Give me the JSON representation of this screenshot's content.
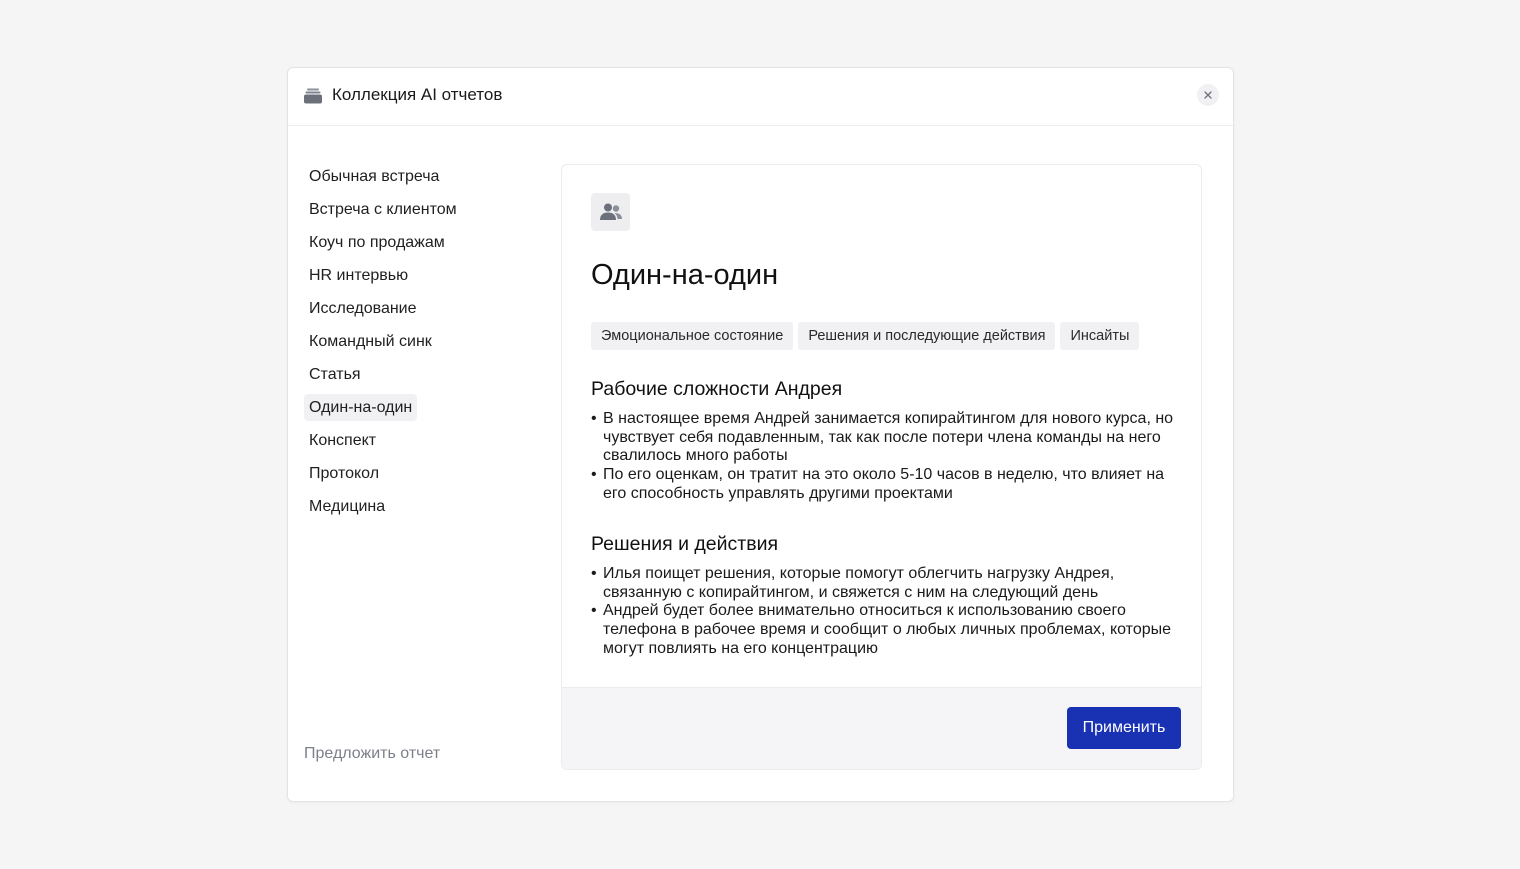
{
  "dialog": {
    "title": "Коллекция AI отчетов",
    "header_icon": "archive-box-icon",
    "close_icon": "close-icon"
  },
  "sidebar": {
    "items": [
      {
        "label": "Обычная встреча"
      },
      {
        "label": "Встреча с клиентом"
      },
      {
        "label": "Коуч по продажам"
      },
      {
        "label": "HR интервью"
      },
      {
        "label": "Исследование"
      },
      {
        "label": "Командный синк"
      },
      {
        "label": "Статья"
      },
      {
        "label": "Один-на-один",
        "active": true
      },
      {
        "label": "Конспект"
      },
      {
        "label": "Протокол"
      },
      {
        "label": "Медицина"
      }
    ],
    "suggest_label": "Предложить отчет"
  },
  "template": {
    "icon": "users-icon",
    "title": "Один-на-один",
    "tags": [
      "Эмоциональное состояние",
      "Решения и последующие действия",
      "Инсайты"
    ],
    "sections": [
      {
        "title": "Рабочие сложности Андрея",
        "bullets": [
          "В настоящее время Андрей занимается копирайтингом для нового курса, но чувствует себя подавленным, так как после потери члена команды на него свалилось много работы",
          "По его оценкам, он тратит на это около 5-10 часов в неделю, что влияет на его способность управлять другими проектами"
        ]
      },
      {
        "title": "Решения и действия",
        "bullets": [
          "Илья поищет решения, которые помогут облегчить нагрузку Андрея, связанную с копирайтингом, и свяжется с ним на следующий день",
          "Андрей будет более внимательно относиться к использованию своего телефона в рабочее время и сообщит о любых личных проблемах, которые могут повлиять на его концентрацию"
        ]
      }
    ],
    "apply_label": "Применить"
  },
  "colors": {
    "accent": "#1932b4",
    "page_background": "#f5f5f6",
    "tag_background": "#f1f1f4",
    "muted_text": "#7c808a"
  }
}
